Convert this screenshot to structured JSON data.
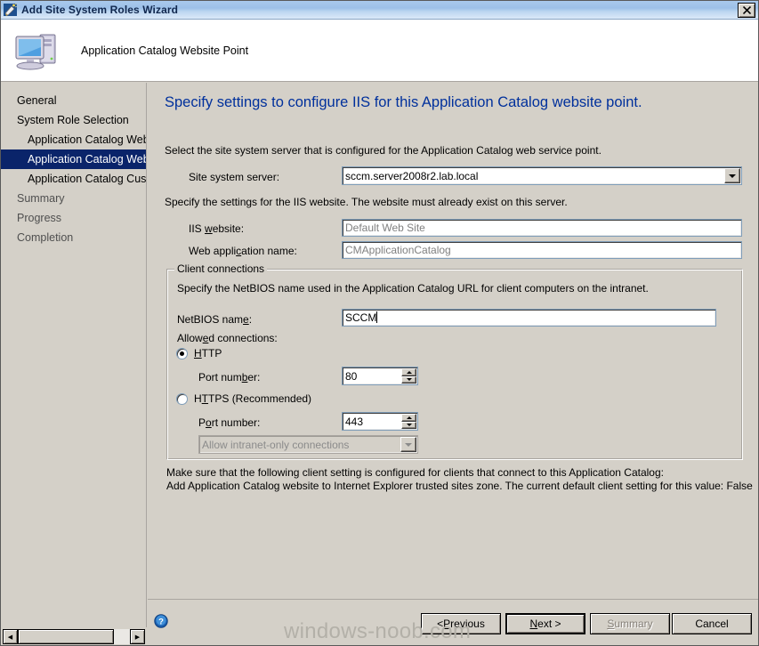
{
  "window": {
    "title": "Add Site System Roles Wizard",
    "icon": "wizard-wand-icon",
    "close_label": "✕"
  },
  "header": {
    "title": "Application Catalog Website Point",
    "icon": "computer-icon"
  },
  "nav": {
    "items": [
      {
        "label": "General",
        "level": 0,
        "state": "normal"
      },
      {
        "label": "System Role Selection",
        "level": 0,
        "state": "normal"
      },
      {
        "label": "Application Catalog Web Se",
        "level": 1,
        "state": "normal"
      },
      {
        "label": "Application Catalog Website",
        "level": 1,
        "state": "selected"
      },
      {
        "label": "Application Catalog Customi",
        "level": 1,
        "state": "normal"
      },
      {
        "label": "Summary",
        "level": 0,
        "state": "dim"
      },
      {
        "label": "Progress",
        "level": 0,
        "state": "dim"
      },
      {
        "label": "Completion",
        "level": 0,
        "state": "dim"
      }
    ]
  },
  "main": {
    "heading": "Specify settings to configure IIS for this Application Catalog website point.",
    "server_desc": "Select the site system server that is configured for the Application Catalog web service point.",
    "site_system_server_label": "Site system server:",
    "site_system_server_value": "sccm.server2008r2.lab.local",
    "iis_desc": "Specify the settings for the IIS website. The website must already exist on this server.",
    "iis_website_label_pre": "IIS ",
    "iis_website_label_uk": "w",
    "iis_website_label_post": "ebsite:",
    "iis_website_value": "Default Web Site",
    "web_app_label_pre": "Web appli",
    "web_app_label_uk": "c",
    "web_app_label_post": "ation name:",
    "web_app_value": "CMApplicationCatalog",
    "client_connections_title": "Client connections",
    "netbios_desc": "Specify the NetBIOS name used in the Application Catalog URL for client computers on the intranet.",
    "netbios_label_pre": "NetBIOS nam",
    "netbios_label_uk": "e",
    "netbios_label_post": ":",
    "netbios_value": "SCCM",
    "allowed_connections_label_pre": "Allow",
    "allowed_connections_label_uk": "e",
    "allowed_connections_label_post": "d connections:",
    "http_label_pre": "",
    "http_label_uk": "H",
    "http_label_post": "TTP",
    "http_selected": true,
    "http_port_label_pre": "Port num",
    "http_port_label_uk": "b",
    "http_port_label_post": "er:",
    "http_port_value": "80",
    "https_label_pre": "H",
    "https_label_uk": "T",
    "https_label_post": "TPS (Recommended)",
    "https_selected": false,
    "https_port_label_pre": "P",
    "https_port_label_uk": "o",
    "https_port_label_post": "rt number:",
    "https_port_value": "443",
    "intranet_combo_value": "Allow intranet-only connections",
    "note_line1": "Make sure that the following client setting is configured for clients that connect to this Application Catalog:",
    "note_line2": "Add Application Catalog website to Internet Explorer trusted sites zone. The current default client setting for this value: False"
  },
  "buttons": {
    "help_icon": "help-icon",
    "previous_pre": "< ",
    "previous_uk": "P",
    "previous_post": "revious",
    "next_pre": "",
    "next_uk": "N",
    "next_post": "ext >",
    "summary_pre": "",
    "summary_uk": "S",
    "summary_post": "ummary",
    "cancel": "Cancel"
  },
  "scrollbar": {
    "left_arrow": "◀",
    "right_arrow": "▶"
  },
  "watermark": "windows-noob.com",
  "colors": {
    "face": "#d4d0c8",
    "heading": "#00309c",
    "selection": "#0a246a",
    "disabled_text": "#808080"
  }
}
